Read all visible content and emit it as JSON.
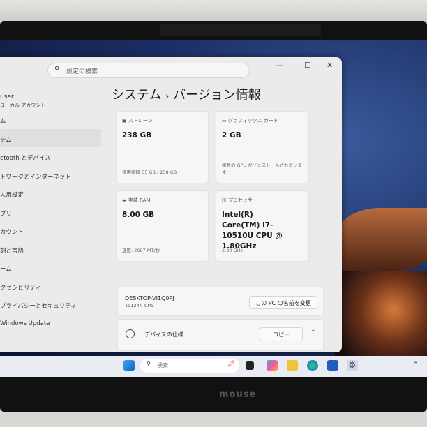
{
  "settings": {
    "search_placeholder": "設定の検索",
    "user": {
      "name": "user",
      "account_type": "ローカル アカウント"
    },
    "nav": [
      "ム",
      "テム",
      "etooth とデバイス",
      "トワークとインターネット",
      "人用設定",
      "プリ",
      "カウント",
      "刻と言語",
      "ーム",
      "クセシビリティ",
      "プライバシーとセキュリティ",
      "Windows Update"
    ],
    "breadcrumb": {
      "parent": "システム",
      "sep": "›",
      "current": "バージョン情報"
    },
    "cards": [
      {
        "label": "ストレージ",
        "value": "238 GB",
        "sub": "使用領域 55 GB / 238 GB"
      },
      {
        "label": "グラフィックス カード",
        "value": "2 GB",
        "sub": "複数の GPU がインストールされています"
      },
      {
        "label": "実装 RAM",
        "value": "8.00 GB",
        "sub": "速度: 2667 MT/秒"
      },
      {
        "label": "プロセッサ",
        "value": "Intel(R) Core(TM) i7-10510U CPU @ 1.80GHz",
        "sub": "2.30 GHz"
      }
    ],
    "device_name": "DESKTOP-VI1Q0PJ",
    "model": "19124N-CML",
    "rename_label": "この PC の名前を変更",
    "device_spec_label": "デバイスの仕様",
    "copy_label": "コピー"
  },
  "taskbar": {
    "search_label": "検索"
  },
  "brand": "mouse"
}
